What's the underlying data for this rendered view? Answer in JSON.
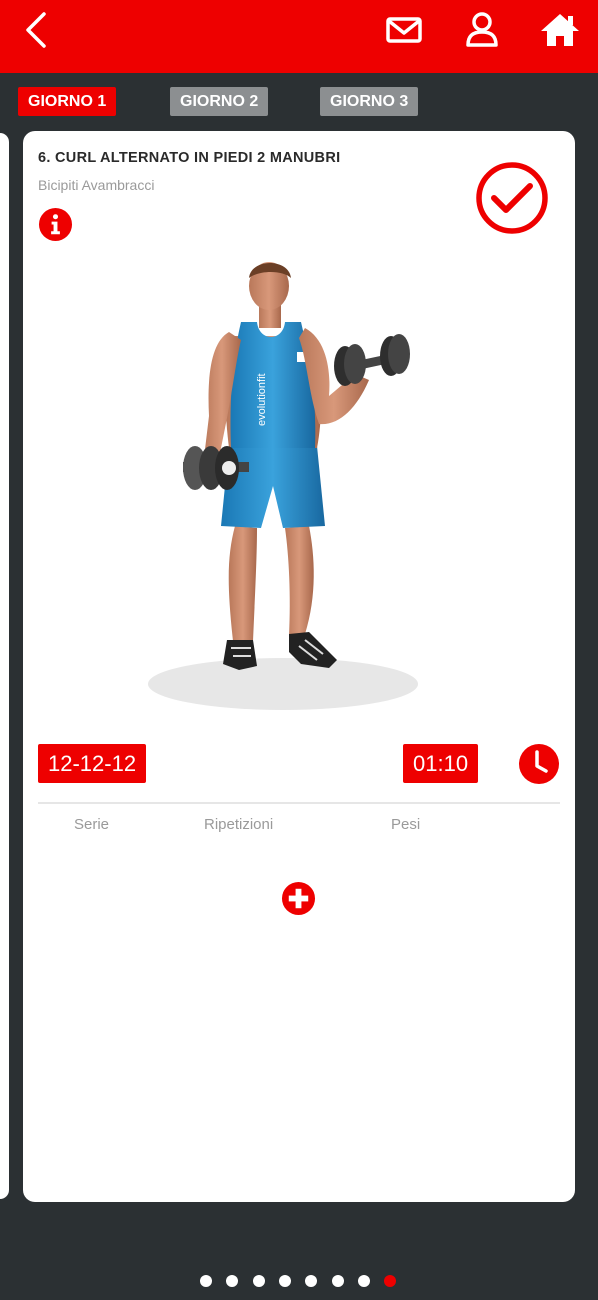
{
  "header": {
    "icons": [
      "chevron-left-icon",
      "mail-icon",
      "user-icon",
      "home-icon"
    ],
    "accent_color": "#ee0000"
  },
  "tabs": [
    {
      "label": "GIORNO 1",
      "active": true
    },
    {
      "label": "GIORNO 2",
      "active": false
    },
    {
      "label": "GIORNO 3",
      "active": false
    }
  ],
  "exercise": {
    "title": "6. CURL ALTERNATO IN PIEDI 2 MANUBRI",
    "muscles": "Bicipiti Avambracci",
    "completed": true,
    "reps": "12-12-12",
    "rest": "01:10",
    "shirt_logo": "evolutionfit"
  },
  "table": {
    "columns": [
      "Serie",
      "Ripetizioni",
      "Pesi"
    ]
  },
  "pagination": {
    "count": 8,
    "active_index": 7
  }
}
